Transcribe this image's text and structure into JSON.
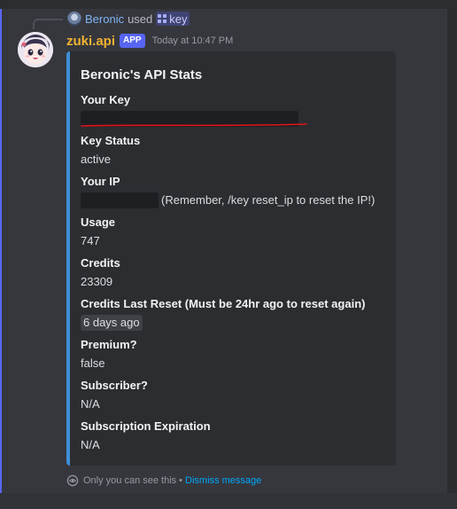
{
  "reply": {
    "user": "Beronic",
    "used_text": "used",
    "command": "key"
  },
  "message": {
    "bot_name": "zuki.api",
    "badge": "APP",
    "timestamp": "Today at 10:47 PM"
  },
  "embed": {
    "accent_color": "#3f8fd9",
    "title": "Beronic's API Stats",
    "fields": [
      {
        "name": "Your Key",
        "value": ""
      },
      {
        "name": "Key Status",
        "value": "active"
      },
      {
        "name": "Your IP",
        "value": "(Remember, /key reset_ip to reset the IP!)"
      },
      {
        "name": "Usage",
        "value": "747"
      },
      {
        "name": "Credits",
        "value": "23309"
      },
      {
        "name": "Credits Last Reset (Must be 24hr ago to reset again)",
        "value": "6 days ago"
      },
      {
        "name": "Premium?",
        "value": "false"
      },
      {
        "name": "Subscriber?",
        "value": "N/A"
      },
      {
        "name": "Subscription Expiration",
        "value": "N/A"
      }
    ]
  },
  "footer": {
    "only_you": "Only you can see this",
    "separator": "•",
    "dismiss": "Dismiss message"
  },
  "colors": {
    "bot_name": "#f0b232",
    "app_badge": "#5865f2",
    "link": "#00a8fc",
    "underline_annotation": "#e0141a"
  },
  "icons": {
    "reply_avatar": "user-avatar-icon",
    "command": "slash-command-icon",
    "ephemeral": "eye-icon"
  }
}
